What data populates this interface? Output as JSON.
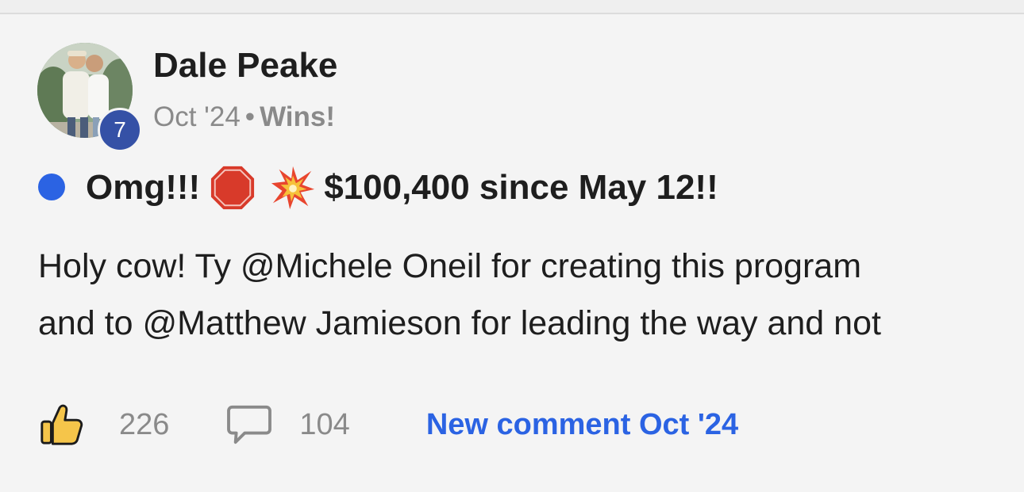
{
  "post": {
    "author": "Dale Peake",
    "level": "7",
    "date": "Oct '24",
    "separator": "•",
    "category": "Wins!",
    "title_prefix": "Omg!!!",
    "title_suffix": "$100,400 since May 12!!",
    "title_emojis": [
      "stop-sign-emoji",
      "collision-emoji"
    ],
    "body_lines": [
      "Holy cow! Ty @Michele Oneil for creating this program",
      "and to @Matthew Jamieson for leading the way and not"
    ],
    "likes": "226",
    "comments": "104",
    "new_comment_label": "New comment Oct '24"
  },
  "colors": {
    "accent": "#2b63e3",
    "level_badge": "#3551a6",
    "meta_text": "#8a8a8a",
    "background": "#f4f4f4"
  },
  "icons": {
    "like": "thumbs-up-icon",
    "comment": "speech-bubble-icon"
  }
}
